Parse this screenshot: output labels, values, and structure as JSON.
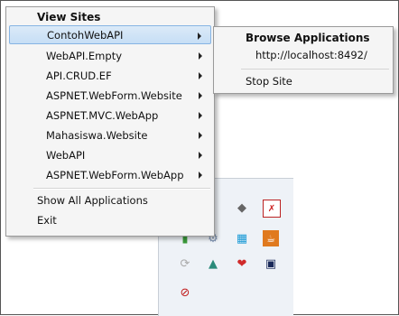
{
  "menu": {
    "header": "View Sites",
    "sites": [
      {
        "label": "ContohWebAPI",
        "selected": true
      },
      {
        "label": "WebAPI.Empty"
      },
      {
        "label": "API.CRUD.EF"
      },
      {
        "label": "ASPNET.WebForm.Website"
      },
      {
        "label": "ASPNET.MVC.WebApp"
      },
      {
        "label": "Mahasiswa.Website"
      },
      {
        "label": "WebAPI"
      },
      {
        "label": "ASPNET.WebForm.WebApp"
      }
    ],
    "show_all": "Show All Applications",
    "exit": "Exit"
  },
  "submenu": {
    "title": "Browse Applications",
    "url": "http://localhost:8492/",
    "stop": "Stop Site"
  },
  "tray": {
    "icons": [
      "cloud-icon",
      "diamond-icon",
      "network-error-icon",
      "battery-icon",
      "gear-icon",
      "grid-icon",
      "java-icon",
      "sync-icon",
      "chart-icon",
      "heart-icon",
      "monitor-icon",
      "blocked-icon"
    ]
  },
  "colors": {
    "selection": "#c6def5",
    "selection_border": "#86b4e3"
  }
}
